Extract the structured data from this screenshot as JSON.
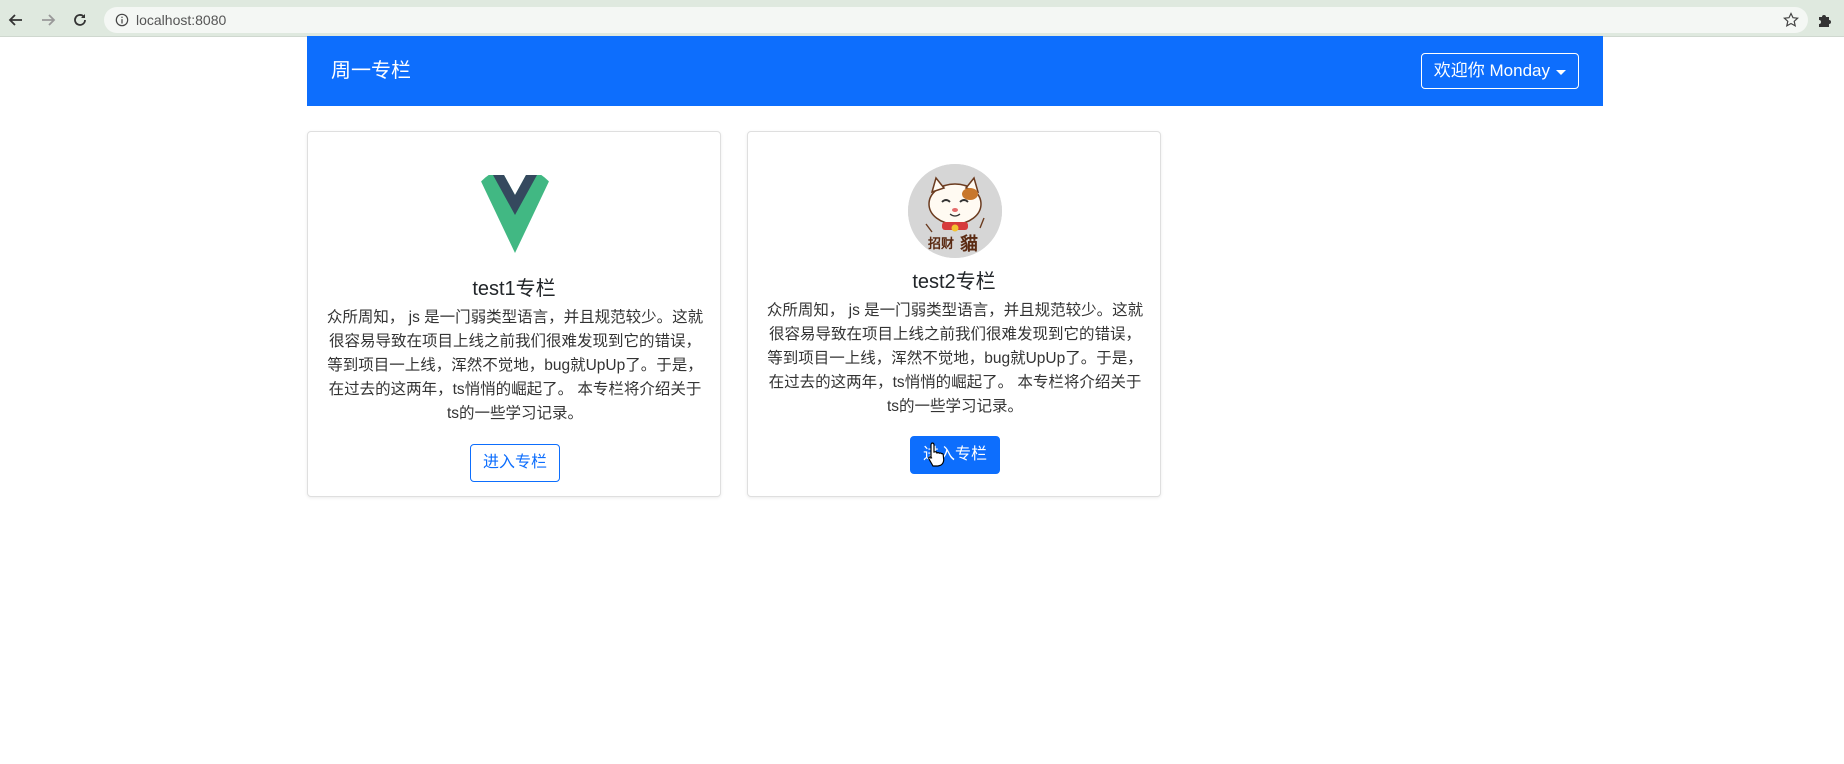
{
  "browser": {
    "url": "localhost:8080",
    "icons": [
      "back-arrow-icon",
      "forward-arrow-icon",
      "reload-icon",
      "info-icon",
      "star-icon",
      "puzzle-icon"
    ]
  },
  "navbar": {
    "brand": "周一专栏",
    "user_menu_label": "欢迎你 Monday",
    "background": "#0d6efd"
  },
  "columns": [
    {
      "title": "test1专栏",
      "description": "众所周知， js 是一门弱类型语言，并且规范较少。这就很容易导致在项目上线之前我们很难发现到它的错误，等到项目一上线，浑然不觉地，bug就UpUp了。于是，在过去的这两年，ts悄悄的崛起了。 本专栏将介绍关于ts的一些学习记录。",
      "button_label": "进入专栏",
      "avatar": "vue-logo"
    },
    {
      "title": "test2专栏",
      "description": "众所周知， js 是一门弱类型语言，并且规范较少。这就很容易导致在项目上线之前我们很难发现到它的错误，等到项目一上线，浑然不觉地，bug就UpUp了。于是，在过去的这两年，ts悄悄的崛起了。 本专栏将介绍关于ts的一些学习记录。",
      "button_label": "进入专栏",
      "avatar": "lucky-cat-logo",
      "avatar_text": "招财猫"
    }
  ]
}
